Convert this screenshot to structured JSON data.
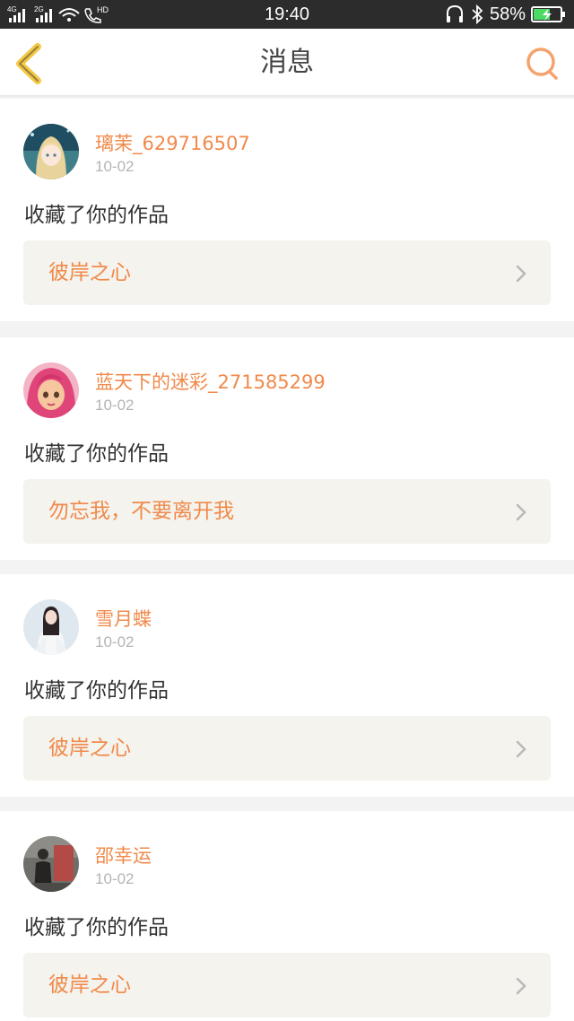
{
  "status_bar": {
    "network_left": "4G",
    "network_right": "2G",
    "hd": "HD",
    "time": "19:40",
    "battery": "58%"
  },
  "nav": {
    "title": "消息"
  },
  "notifications": [
    {
      "user": "璃茉_629716507",
      "date": "10-02",
      "action": "收藏了你的作品",
      "work": "彼岸之心",
      "avatar_icon": "anime-girl-avatar-icon"
    },
    {
      "user": "蓝天下的迷彩_271585299",
      "date": "10-02",
      "action": "收藏了你的作品",
      "work": "勿忘我，不要离开我",
      "avatar_icon": "cartoon-girl-pink-hair-avatar-icon"
    },
    {
      "user": "雪月蝶",
      "date": "10-02",
      "action": "收藏了你的作品",
      "work": "彼岸之心",
      "avatar_icon": "woman-white-dress-avatar-icon"
    },
    {
      "user": "邵幸运",
      "date": "10-02",
      "action": "收藏了你的作品",
      "work": "彼岸之心",
      "avatar_icon": "person-photo-avatar-icon"
    }
  ],
  "colors": {
    "accent": "#f08a4b",
    "back_arrow": "#f3c844",
    "work_box_bg": "#f4f3ed"
  }
}
